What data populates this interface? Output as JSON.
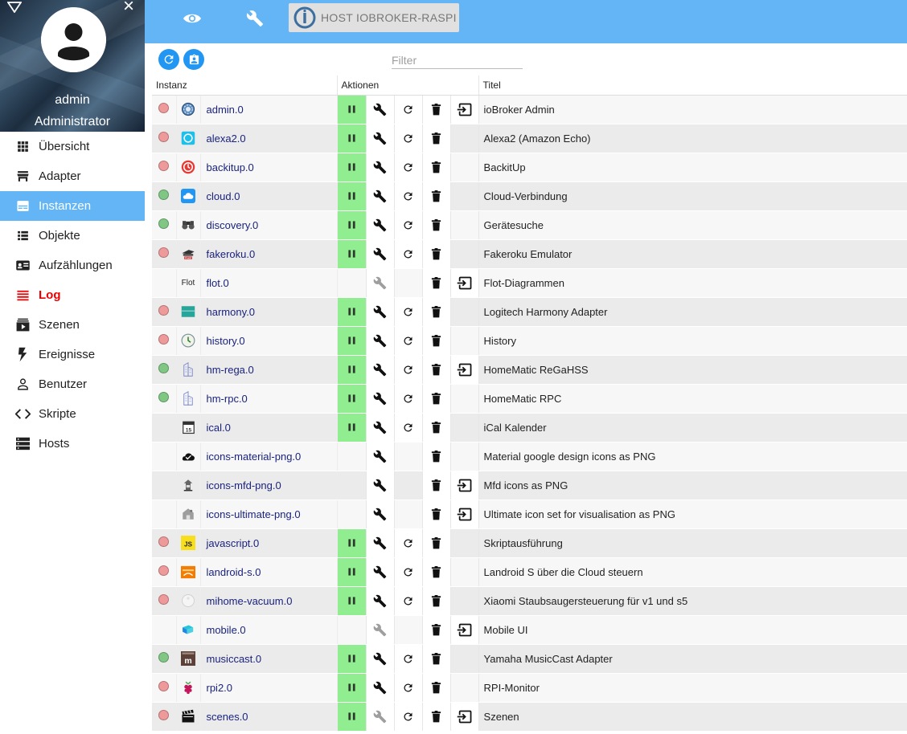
{
  "sidebar": {
    "user_name": "admin",
    "user_role": "Administrator",
    "items": [
      {
        "name": "overview",
        "label": "Übersicht",
        "icon": "grid-icon",
        "active": false,
        "warn": false
      },
      {
        "name": "adapters",
        "label": "Adapter",
        "icon": "store-icon",
        "active": false,
        "warn": false
      },
      {
        "name": "instances",
        "label": "Instanzen",
        "icon": "instances-icon",
        "active": true,
        "warn": false
      },
      {
        "name": "objects",
        "label": "Objekte",
        "icon": "list-icon",
        "active": false,
        "warn": false
      },
      {
        "name": "enums",
        "label": "Aufzählungen",
        "icon": "enum-icon",
        "active": false,
        "warn": false
      },
      {
        "name": "log",
        "label": "Log",
        "icon": "log-icon",
        "active": false,
        "warn": true
      },
      {
        "name": "scenes",
        "label": "Szenen",
        "icon": "scenes-icon",
        "active": false,
        "warn": false
      },
      {
        "name": "events",
        "label": "Ereignisse",
        "icon": "flash-icon",
        "active": false,
        "warn": false
      },
      {
        "name": "users",
        "label": "Benutzer",
        "icon": "person-icon",
        "active": false,
        "warn": false
      },
      {
        "name": "scripts",
        "label": "Skripte",
        "icon": "code-icon",
        "active": false,
        "warn": false
      },
      {
        "name": "hosts",
        "label": "Hosts",
        "icon": "server-icon",
        "active": false,
        "warn": false
      }
    ]
  },
  "topbar": {
    "host_label": "HOST IOBROKER-RASPI"
  },
  "toolbar": {
    "filter_placeholder": "Filter"
  },
  "table": {
    "headers": {
      "instance": "Instanz",
      "actions": "Aktionen",
      "title": "Titel"
    },
    "rows": [
      {
        "name": "admin.0",
        "title": "ioBroker Admin",
        "status": "red",
        "icon": "admin-icon",
        "run": true,
        "restart": true,
        "link": true,
        "wrench_disabled": false
      },
      {
        "name": "alexa2.0",
        "title": "Alexa2 (Amazon Echo)",
        "status": "red",
        "icon": "alexa-icon",
        "run": true,
        "restart": true,
        "link": false,
        "wrench_disabled": false
      },
      {
        "name": "backitup.0",
        "title": "BackitUp",
        "status": "red",
        "icon": "backitup-icon",
        "run": true,
        "restart": true,
        "link": false,
        "wrench_disabled": false
      },
      {
        "name": "cloud.0",
        "title": "Cloud-Verbindung",
        "status": "green",
        "icon": "cloud-icon",
        "run": true,
        "restart": true,
        "link": false,
        "wrench_disabled": false
      },
      {
        "name": "discovery.0",
        "title": "Gerätesuche",
        "status": "green",
        "icon": "binoculars-icon",
        "run": true,
        "restart": true,
        "link": false,
        "wrench_disabled": false
      },
      {
        "name": "fakeroku.0",
        "title": "Fakeroku Emulator",
        "status": "red",
        "icon": "fakeroku-icon",
        "run": true,
        "restart": true,
        "link": false,
        "wrench_disabled": false
      },
      {
        "name": "flot.0",
        "title": "Flot-Diagrammen",
        "status": "none",
        "icon": "flot-icon",
        "icon_text": "Flot",
        "run": false,
        "restart": false,
        "link": true,
        "wrench_disabled": true
      },
      {
        "name": "harmony.0",
        "title": "Logitech Harmony Adapter",
        "status": "red",
        "icon": "harmony-icon",
        "run": true,
        "restart": true,
        "link": false,
        "wrench_disabled": false
      },
      {
        "name": "history.0",
        "title": "History",
        "status": "red",
        "icon": "history-icon",
        "run": true,
        "restart": true,
        "link": false,
        "wrench_disabled": false
      },
      {
        "name": "hm-rega.0",
        "title": "HomeMatic ReGaHSS",
        "status": "green",
        "icon": "homematic-icon",
        "run": true,
        "restart": true,
        "link": true,
        "wrench_disabled": false
      },
      {
        "name": "hm-rpc.0",
        "title": "HomeMatic RPC",
        "status": "green",
        "icon": "homematic-icon",
        "run": true,
        "restart": true,
        "link": false,
        "wrench_disabled": false
      },
      {
        "name": "ical.0",
        "title": "iCal Kalender",
        "status": "none",
        "icon": "calendar-icon",
        "icon_text": "15",
        "run": true,
        "restart": true,
        "link": false,
        "wrench_disabled": false
      },
      {
        "name": "icons-material-png.0",
        "title": "Material google design icons as PNG",
        "status": "none",
        "icon": "cloud-check-icon",
        "run": false,
        "restart": false,
        "link": false,
        "wrench_disabled": false
      },
      {
        "name": "icons-mfd-png.0",
        "title": "Mfd icons as PNG",
        "status": "none",
        "icon": "mfd-icon",
        "run": false,
        "restart": false,
        "link": true,
        "wrench_disabled": false
      },
      {
        "name": "icons-ultimate-png.0",
        "title": "Ultimate icon set for visualisation as PNG",
        "status": "none",
        "icon": "ultimate-icon",
        "run": false,
        "restart": false,
        "link": true,
        "wrench_disabled": false
      },
      {
        "name": "javascript.0",
        "title": "Skriptausführung",
        "status": "red",
        "icon": "javascript-icon",
        "icon_text": "JS",
        "run": true,
        "restart": true,
        "link": false,
        "wrench_disabled": false
      },
      {
        "name": "landroid-s.0",
        "title": "Landroid S über die Cloud steuern",
        "status": "red",
        "icon": "landroid-icon",
        "run": true,
        "restart": true,
        "link": false,
        "wrench_disabled": false
      },
      {
        "name": "mihome-vacuum.0",
        "title": "Xiaomi Staubsaugersteuerung für v1 und s5",
        "status": "red",
        "icon": "vacuum-icon",
        "run": true,
        "restart": true,
        "link": false,
        "wrench_disabled": false
      },
      {
        "name": "mobile.0",
        "title": "Mobile UI",
        "status": "none",
        "icon": "mobile-icon",
        "run": false,
        "restart": false,
        "link": true,
        "wrench_disabled": true
      },
      {
        "name": "musiccast.0",
        "title": "Yamaha MusicCast Adapter",
        "status": "green",
        "icon": "musiccast-icon",
        "icon_text": "m",
        "run": true,
        "restart": true,
        "link": false,
        "wrench_disabled": false
      },
      {
        "name": "rpi2.0",
        "title": "RPI-Monitor",
        "status": "red",
        "icon": "raspberry-icon",
        "run": true,
        "restart": true,
        "link": false,
        "wrench_disabled": false
      },
      {
        "name": "scenes.0",
        "title": "Szenen",
        "status": "red",
        "icon": "clapper-icon",
        "run": true,
        "restart": true,
        "link": true,
        "wrench_disabled": true
      }
    ]
  }
}
